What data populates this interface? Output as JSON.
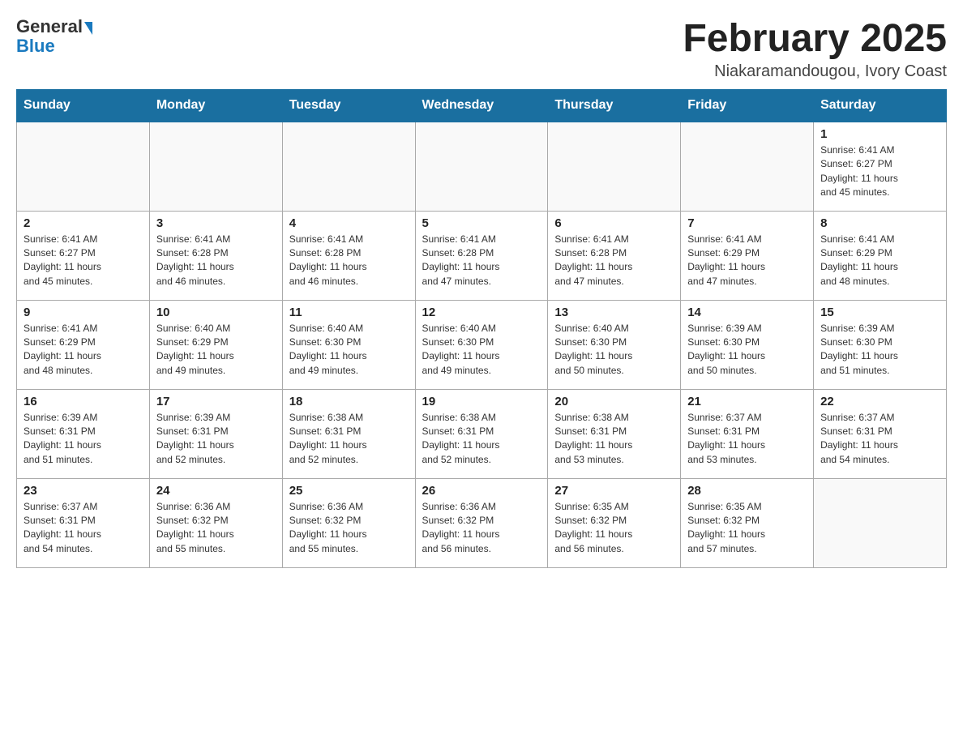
{
  "logo": {
    "general": "General",
    "blue": "Blue"
  },
  "title": "February 2025",
  "location": "Niakaramandougou, Ivory Coast",
  "days_of_week": [
    "Sunday",
    "Monday",
    "Tuesday",
    "Wednesday",
    "Thursday",
    "Friday",
    "Saturday"
  ],
  "weeks": [
    [
      {
        "day": "",
        "info": ""
      },
      {
        "day": "",
        "info": ""
      },
      {
        "day": "",
        "info": ""
      },
      {
        "day": "",
        "info": ""
      },
      {
        "day": "",
        "info": ""
      },
      {
        "day": "",
        "info": ""
      },
      {
        "day": "1",
        "info": "Sunrise: 6:41 AM\nSunset: 6:27 PM\nDaylight: 11 hours\nand 45 minutes."
      }
    ],
    [
      {
        "day": "2",
        "info": "Sunrise: 6:41 AM\nSunset: 6:27 PM\nDaylight: 11 hours\nand 45 minutes."
      },
      {
        "day": "3",
        "info": "Sunrise: 6:41 AM\nSunset: 6:28 PM\nDaylight: 11 hours\nand 46 minutes."
      },
      {
        "day": "4",
        "info": "Sunrise: 6:41 AM\nSunset: 6:28 PM\nDaylight: 11 hours\nand 46 minutes."
      },
      {
        "day": "5",
        "info": "Sunrise: 6:41 AM\nSunset: 6:28 PM\nDaylight: 11 hours\nand 47 minutes."
      },
      {
        "day": "6",
        "info": "Sunrise: 6:41 AM\nSunset: 6:28 PM\nDaylight: 11 hours\nand 47 minutes."
      },
      {
        "day": "7",
        "info": "Sunrise: 6:41 AM\nSunset: 6:29 PM\nDaylight: 11 hours\nand 47 minutes."
      },
      {
        "day": "8",
        "info": "Sunrise: 6:41 AM\nSunset: 6:29 PM\nDaylight: 11 hours\nand 48 minutes."
      }
    ],
    [
      {
        "day": "9",
        "info": "Sunrise: 6:41 AM\nSunset: 6:29 PM\nDaylight: 11 hours\nand 48 minutes."
      },
      {
        "day": "10",
        "info": "Sunrise: 6:40 AM\nSunset: 6:29 PM\nDaylight: 11 hours\nand 49 minutes."
      },
      {
        "day": "11",
        "info": "Sunrise: 6:40 AM\nSunset: 6:30 PM\nDaylight: 11 hours\nand 49 minutes."
      },
      {
        "day": "12",
        "info": "Sunrise: 6:40 AM\nSunset: 6:30 PM\nDaylight: 11 hours\nand 49 minutes."
      },
      {
        "day": "13",
        "info": "Sunrise: 6:40 AM\nSunset: 6:30 PM\nDaylight: 11 hours\nand 50 minutes."
      },
      {
        "day": "14",
        "info": "Sunrise: 6:39 AM\nSunset: 6:30 PM\nDaylight: 11 hours\nand 50 minutes."
      },
      {
        "day": "15",
        "info": "Sunrise: 6:39 AM\nSunset: 6:30 PM\nDaylight: 11 hours\nand 51 minutes."
      }
    ],
    [
      {
        "day": "16",
        "info": "Sunrise: 6:39 AM\nSunset: 6:31 PM\nDaylight: 11 hours\nand 51 minutes."
      },
      {
        "day": "17",
        "info": "Sunrise: 6:39 AM\nSunset: 6:31 PM\nDaylight: 11 hours\nand 52 minutes."
      },
      {
        "day": "18",
        "info": "Sunrise: 6:38 AM\nSunset: 6:31 PM\nDaylight: 11 hours\nand 52 minutes."
      },
      {
        "day": "19",
        "info": "Sunrise: 6:38 AM\nSunset: 6:31 PM\nDaylight: 11 hours\nand 52 minutes."
      },
      {
        "day": "20",
        "info": "Sunrise: 6:38 AM\nSunset: 6:31 PM\nDaylight: 11 hours\nand 53 minutes."
      },
      {
        "day": "21",
        "info": "Sunrise: 6:37 AM\nSunset: 6:31 PM\nDaylight: 11 hours\nand 53 minutes."
      },
      {
        "day": "22",
        "info": "Sunrise: 6:37 AM\nSunset: 6:31 PM\nDaylight: 11 hours\nand 54 minutes."
      }
    ],
    [
      {
        "day": "23",
        "info": "Sunrise: 6:37 AM\nSunset: 6:31 PM\nDaylight: 11 hours\nand 54 minutes."
      },
      {
        "day": "24",
        "info": "Sunrise: 6:36 AM\nSunset: 6:32 PM\nDaylight: 11 hours\nand 55 minutes."
      },
      {
        "day": "25",
        "info": "Sunrise: 6:36 AM\nSunset: 6:32 PM\nDaylight: 11 hours\nand 55 minutes."
      },
      {
        "day": "26",
        "info": "Sunrise: 6:36 AM\nSunset: 6:32 PM\nDaylight: 11 hours\nand 56 minutes."
      },
      {
        "day": "27",
        "info": "Sunrise: 6:35 AM\nSunset: 6:32 PM\nDaylight: 11 hours\nand 56 minutes."
      },
      {
        "day": "28",
        "info": "Sunrise: 6:35 AM\nSunset: 6:32 PM\nDaylight: 11 hours\nand 57 minutes."
      },
      {
        "day": "",
        "info": ""
      }
    ]
  ]
}
